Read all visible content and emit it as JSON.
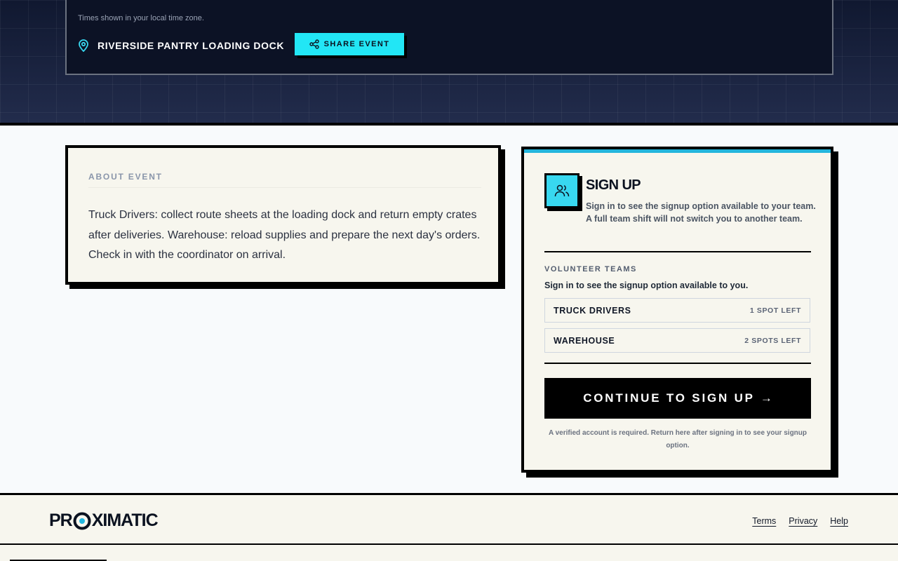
{
  "hero": {
    "timezone_note": "Times shown in your local time zone.",
    "location_icon": "map-pin-icon",
    "location": "RIVERSIDE PANTRY LOADING DOCK",
    "share_button": {
      "icon": "share-icon",
      "label": "SHARE EVENT"
    }
  },
  "about": {
    "title": "ABOUT EVENT",
    "description": "Truck Drivers: collect route sheets at the loading dock and return empty crates after deliveries. Warehouse: reload supplies and prepare the next day's orders. Check in with the coordinator on arrival."
  },
  "signup": {
    "icon": "users-icon",
    "title": "SIGN UP",
    "description": "Sign in to see the signup option available to your team. A full team shift will not switch you to another team.",
    "teams_title": "VOLUNTEER TEAMS",
    "teams_note": "Sign in to see the signup option available to you.",
    "teams": [
      {
        "name": "TRUCK DRIVERS",
        "spots": "1 SPOT LEFT"
      },
      {
        "name": "WAREHOUSE",
        "spots": "2 SPOTS LEFT"
      }
    ],
    "continue_label": "CONTINUE TO SIGN UP",
    "continue_arrow": "→",
    "footnote": "A verified account is required. Return here after signing in to see your signup option."
  },
  "footer": {
    "logo": {
      "before": "PR",
      "after": "XIMATIC"
    },
    "links": [
      "Terms",
      "Privacy",
      "Help"
    ]
  },
  "colors": {
    "hero_bg": "#1a2240",
    "accent_cyan": "#22e6f5",
    "signup_topbar": "#24b5dc",
    "card_bg": "#f7f6ee",
    "ink": "#000000"
  }
}
